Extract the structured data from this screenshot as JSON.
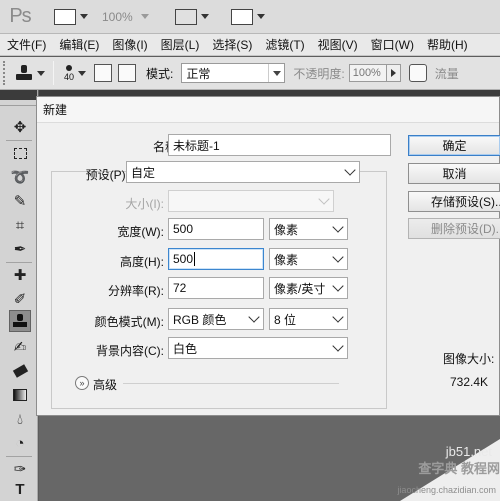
{
  "app": {
    "logo": "Ps",
    "zoom": "100%"
  },
  "menu": [
    "文件(F)",
    "编辑(E)",
    "图像(I)",
    "图层(L)",
    "选择(S)",
    "滤镜(T)",
    "视图(V)",
    "窗口(W)",
    "帮助(H)"
  ],
  "options": {
    "brush_size": "40",
    "mode_label": "模式:",
    "mode_value": "正常",
    "opacity_label": "不透明度:",
    "opacity_value": "100%",
    "flow_label": "流量"
  },
  "toolbar_icons": [
    "move-icon",
    "marquee-icon",
    "lasso-icon",
    "quick-select-icon",
    "crop-icon",
    "eyedropper-icon",
    "healing-brush-icon",
    "brush-icon",
    "clone-stamp-icon",
    "history-brush-icon",
    "eraser-icon",
    "gradient-icon",
    "blur-icon",
    "dodge-icon",
    "pen-icon",
    "type-icon",
    "path-select-icon"
  ],
  "dialog": {
    "title": "新建",
    "name_label": "名称(N):",
    "name_value": "未标题-1",
    "preset_label": "预设(P):",
    "preset_value": "自定",
    "size_label": "大小(I):",
    "width_label": "宽度(W):",
    "width_value": "500",
    "width_unit": "像素",
    "height_label": "高度(H):",
    "height_value": "500",
    "height_unit": "像素",
    "resolution_label": "分辨率(R):",
    "resolution_value": "72",
    "resolution_unit": "像素/英寸",
    "color_mode_label": "颜色模式(M):",
    "color_mode_value": "RGB 颜色",
    "bit_depth_value": "8 位",
    "background_label": "背景内容(C):",
    "background_value": "白色",
    "advanced_label": "高级",
    "image_size_label": "图像大小:",
    "image_size_value": "732.4K",
    "buttons": {
      "ok": "确定",
      "cancel": "取消",
      "save_preset": "存储预设(S)...",
      "delete_preset": "删除预设(D)..."
    }
  },
  "watermark": {
    "site": "jb51.net",
    "brand": "查字典 教程网",
    "url": "jiaocheng.chazidian.com"
  }
}
